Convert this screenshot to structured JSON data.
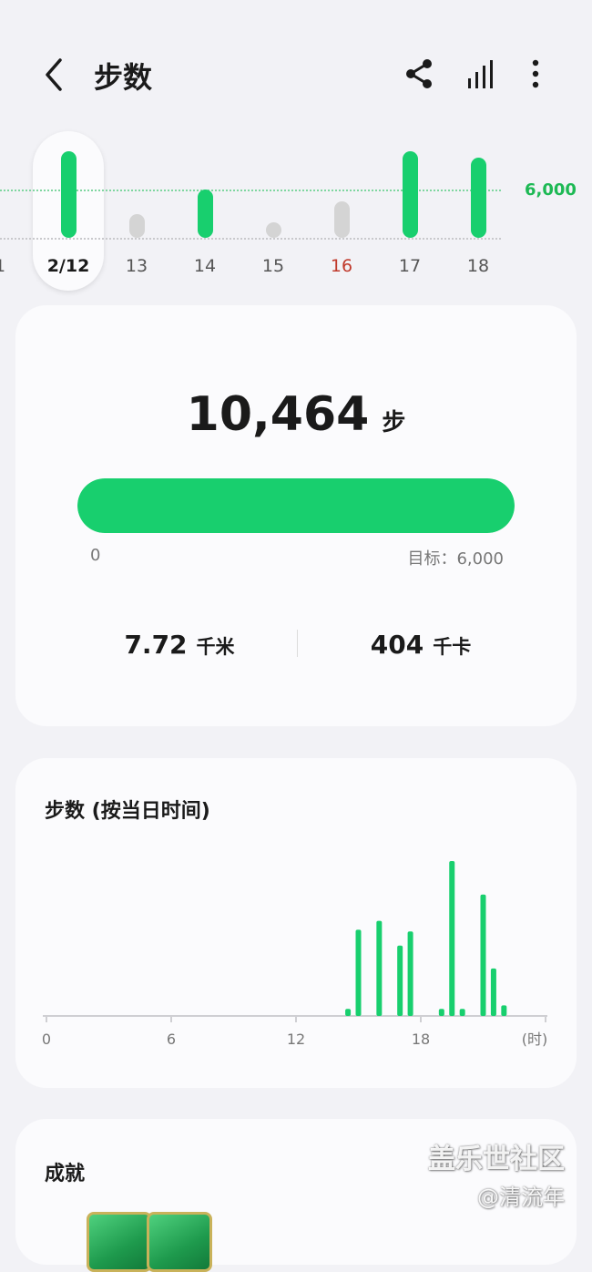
{
  "header": {
    "title": "步数",
    "icons": [
      "back-icon",
      "share-icon",
      "stats-icon",
      "more-icon"
    ]
  },
  "day_strip": {
    "goal_label": "6,000",
    "days": [
      {
        "label": "1",
        "steps": null
      },
      {
        "label": "2/12",
        "steps": 10464,
        "selected": true
      },
      {
        "label": "13",
        "steps": 3000
      },
      {
        "label": "14",
        "steps": 6000
      },
      {
        "label": "15",
        "steps": 500
      },
      {
        "label": "16",
        "steps": 4500,
        "weekend": true
      },
      {
        "label": "17",
        "steps": 10800
      },
      {
        "label": "18",
        "steps": 9500
      }
    ]
  },
  "summary": {
    "steps": "10,464",
    "steps_unit": "步",
    "progress_min": "0",
    "goal_text": "目标：6,000",
    "progress_fraction": 1.0,
    "distance_value": "7.72",
    "distance_unit": "千米",
    "calories_value": "404",
    "calories_unit": "千卡"
  },
  "hourly": {
    "title": "步数 (按当日时间)",
    "chart_data": {
      "type": "bar",
      "x_ticks": [
        "0",
        "6",
        "12",
        "18"
      ],
      "x_unit": "(时)",
      "xlim": [
        0,
        24
      ],
      "bars": [
        {
          "hour": 14.5,
          "value": 4
        },
        {
          "hour": 15.0,
          "value": 49
        },
        {
          "hour": 16.0,
          "value": 54
        },
        {
          "hour": 17.0,
          "value": 40
        },
        {
          "hour": 17.5,
          "value": 48
        },
        {
          "hour": 19.0,
          "value": 4
        },
        {
          "hour": 19.5,
          "value": 88
        },
        {
          "hour": 20.0,
          "value": 4
        },
        {
          "hour": 21.0,
          "value": 69
        },
        {
          "hour": 21.5,
          "value": 27
        },
        {
          "hour": 22.0,
          "value": 6
        }
      ]
    }
  },
  "achievements": {
    "title": "成就"
  },
  "watermark": {
    "brand": "盖乐世社区",
    "user": "@清流年"
  },
  "colors": {
    "accent_green": "#18cf6e",
    "goal_green": "#1db954",
    "gray_bar": "#d4d4d4",
    "weekend_red": "#c0392b"
  }
}
